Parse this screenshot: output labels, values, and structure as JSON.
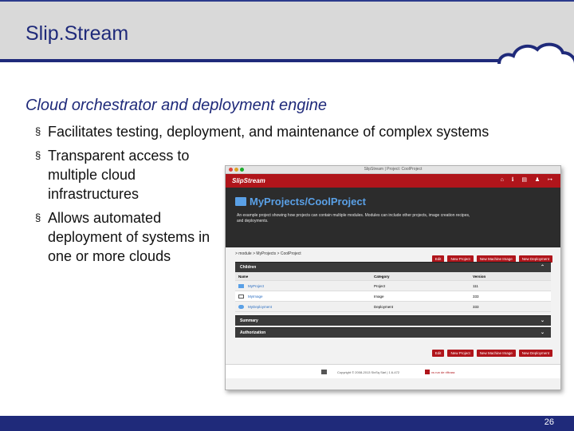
{
  "slide": {
    "title": "Slip.Stream",
    "subtitle": "Cloud orchestrator and deployment engine",
    "bullets": [
      "Facilitates testing, deployment, and maintenance of complex systems",
      "Transparent access to multiple cloud infrastructures",
      "Allows automated deployment of systems in one or more clouds"
    ],
    "bullet_marker": "§",
    "page_number": "26"
  },
  "screenshot": {
    "window_title": "SlipStream | Project: CoolProject",
    "app_name": "SlipStream",
    "nav_icons": "⌂ ℹ ▤ ♟ ↦",
    "project_title": "MyProjects/CoolProject",
    "description": "An example project showing how projects can contain multiple modules. Modules can include other projects, image creation recipes, and deployments.",
    "breadcrumb": "> module > MyProjects > CoolProject",
    "buttons": [
      "Edit",
      "New Project",
      "New Machine Image",
      "New Deployment"
    ],
    "children_label": "Children",
    "columns": [
      "Name",
      "Category",
      "Version"
    ],
    "rows": [
      {
        "name": "MyProject",
        "category": "Project",
        "version": "111",
        "icon": "folder-icon"
      },
      {
        "name": "MyImage",
        "category": "Image",
        "version": "333",
        "icon": "monitor-icon"
      },
      {
        "name": "MyDeployment",
        "category": "Deployment",
        "version": "333",
        "icon": "cloud-icon"
      }
    ],
    "summary_label": "Summary",
    "authorization_label": "Authorization",
    "footer_copyright": "Copyright © 2008-2013 SixSq Sàrl | 1.6-472",
    "footer_link": "vs run de r/ftrara"
  },
  "colors": {
    "title_blue": "#1f2a7a",
    "header_gray": "#d9d9d9",
    "app_red": "#b0151b",
    "hero_dark": "#2c2c2c",
    "link_blue": "#2d6fc2"
  }
}
